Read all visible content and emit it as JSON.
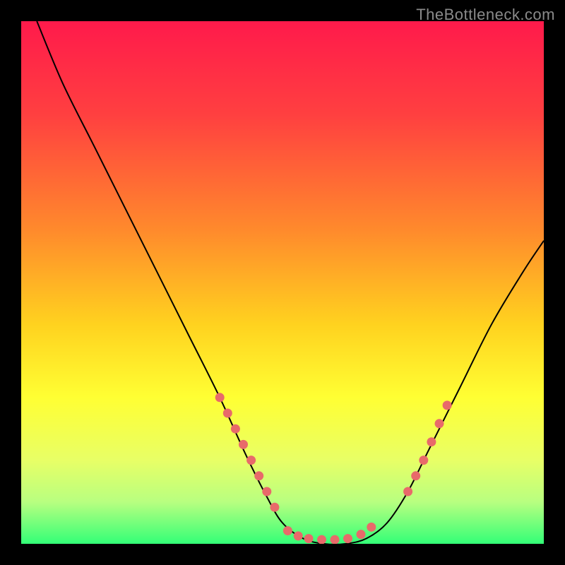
{
  "watermark": "TheBottleneck.com",
  "chart_data": {
    "type": "line",
    "title": "",
    "xlabel": "",
    "ylabel": "",
    "xlim": [
      0,
      100
    ],
    "ylim": [
      0,
      100
    ],
    "background_gradient": {
      "stops": [
        {
          "offset": 0,
          "color": "#ff1a4b"
        },
        {
          "offset": 18,
          "color": "#ff4040"
        },
        {
          "offset": 40,
          "color": "#ff8a2c"
        },
        {
          "offset": 58,
          "color": "#ffd21f"
        },
        {
          "offset": 72,
          "color": "#ffff33"
        },
        {
          "offset": 84,
          "color": "#e8ff66"
        },
        {
          "offset": 92,
          "color": "#b8ff80"
        },
        {
          "offset": 100,
          "color": "#33ff77"
        }
      ]
    },
    "series": [
      {
        "name": "bottleneck-curve",
        "color": "#000000",
        "x": [
          3,
          8,
          14,
          20,
          26,
          32,
          38,
          43,
          47,
          50,
          54,
          58,
          62,
          66,
          70,
          74,
          78,
          84,
          90,
          96,
          100
        ],
        "y": [
          100,
          88,
          76,
          64,
          52,
          40,
          28,
          17,
          9,
          4,
          1,
          0,
          0,
          1,
          4,
          10,
          18,
          30,
          42,
          52,
          58
        ]
      }
    ],
    "dot_clusters": [
      {
        "name": "left-descent-dots",
        "color": "#e86a6a",
        "points": [
          {
            "x": 38,
            "y": 28
          },
          {
            "x": 39.5,
            "y": 25
          },
          {
            "x": 41,
            "y": 22
          },
          {
            "x": 42.5,
            "y": 19
          },
          {
            "x": 44,
            "y": 16
          },
          {
            "x": 45.5,
            "y": 13
          },
          {
            "x": 47,
            "y": 10
          },
          {
            "x": 48.5,
            "y": 7
          }
        ]
      },
      {
        "name": "valley-floor-dots",
        "color": "#e86a6a",
        "points": [
          {
            "x": 51,
            "y": 2.5
          },
          {
            "x": 53,
            "y": 1.5
          },
          {
            "x": 55,
            "y": 1
          },
          {
            "x": 57.5,
            "y": 0.8
          },
          {
            "x": 60,
            "y": 0.8
          },
          {
            "x": 62.5,
            "y": 1
          },
          {
            "x": 65,
            "y": 1.8
          },
          {
            "x": 67,
            "y": 3.2
          }
        ]
      },
      {
        "name": "right-ascent-dots",
        "color": "#e86a6a",
        "points": [
          {
            "x": 74,
            "y": 10
          },
          {
            "x": 75.5,
            "y": 13
          },
          {
            "x": 77,
            "y": 16
          },
          {
            "x": 78.5,
            "y": 19.5
          },
          {
            "x": 80,
            "y": 23
          },
          {
            "x": 81.5,
            "y": 26.5
          }
        ]
      }
    ]
  }
}
